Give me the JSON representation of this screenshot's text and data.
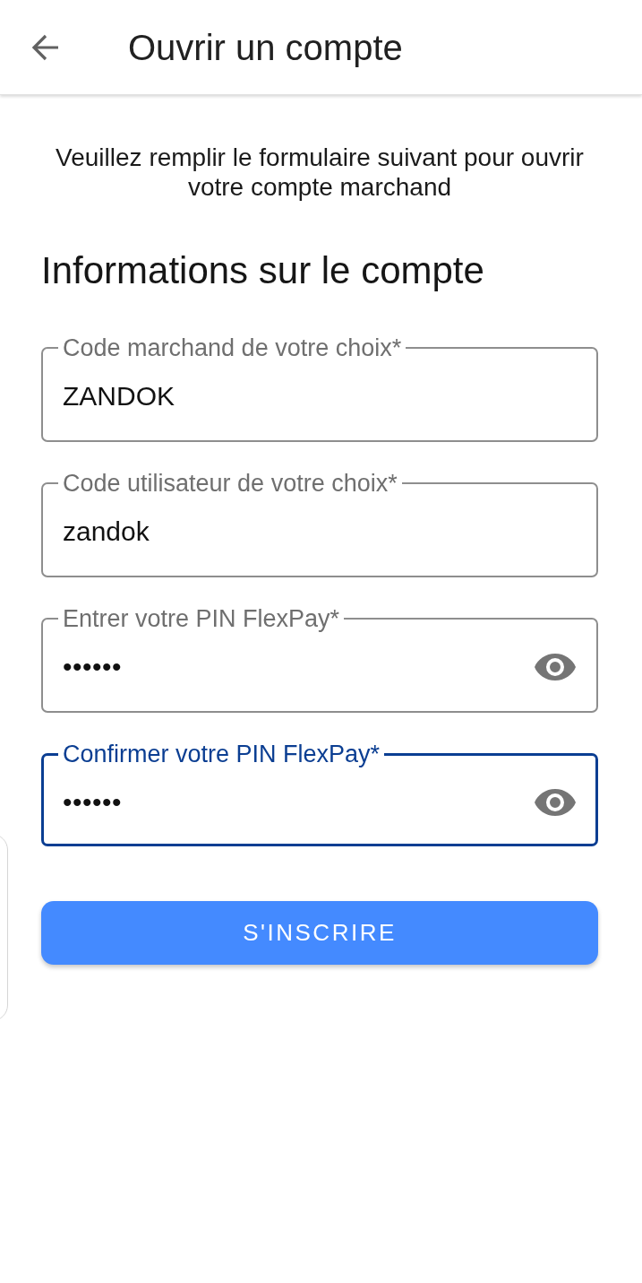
{
  "app_bar": {
    "title": "Ouvrir un compte"
  },
  "intro": "Veuillez remplir le formulaire suivant pour ouvrir votre compte marchand",
  "section_title": "Informations sur le compte",
  "fields": [
    {
      "kind": "text",
      "label": "Code marchand de votre choix*",
      "value": "ZANDOK",
      "focused": false
    },
    {
      "kind": "text",
      "label": "Code utilisateur de votre choix*",
      "value": "zandok",
      "focused": false
    },
    {
      "kind": "password",
      "label": "Entrer votre PIN FlexPay*",
      "value": "••••••",
      "focused": false
    },
    {
      "kind": "password",
      "label": "Confirmer votre PIN FlexPay*",
      "value": "••••••",
      "focused": true
    }
  ],
  "submit_button": {
    "label": "S'INSCRIRE"
  }
}
